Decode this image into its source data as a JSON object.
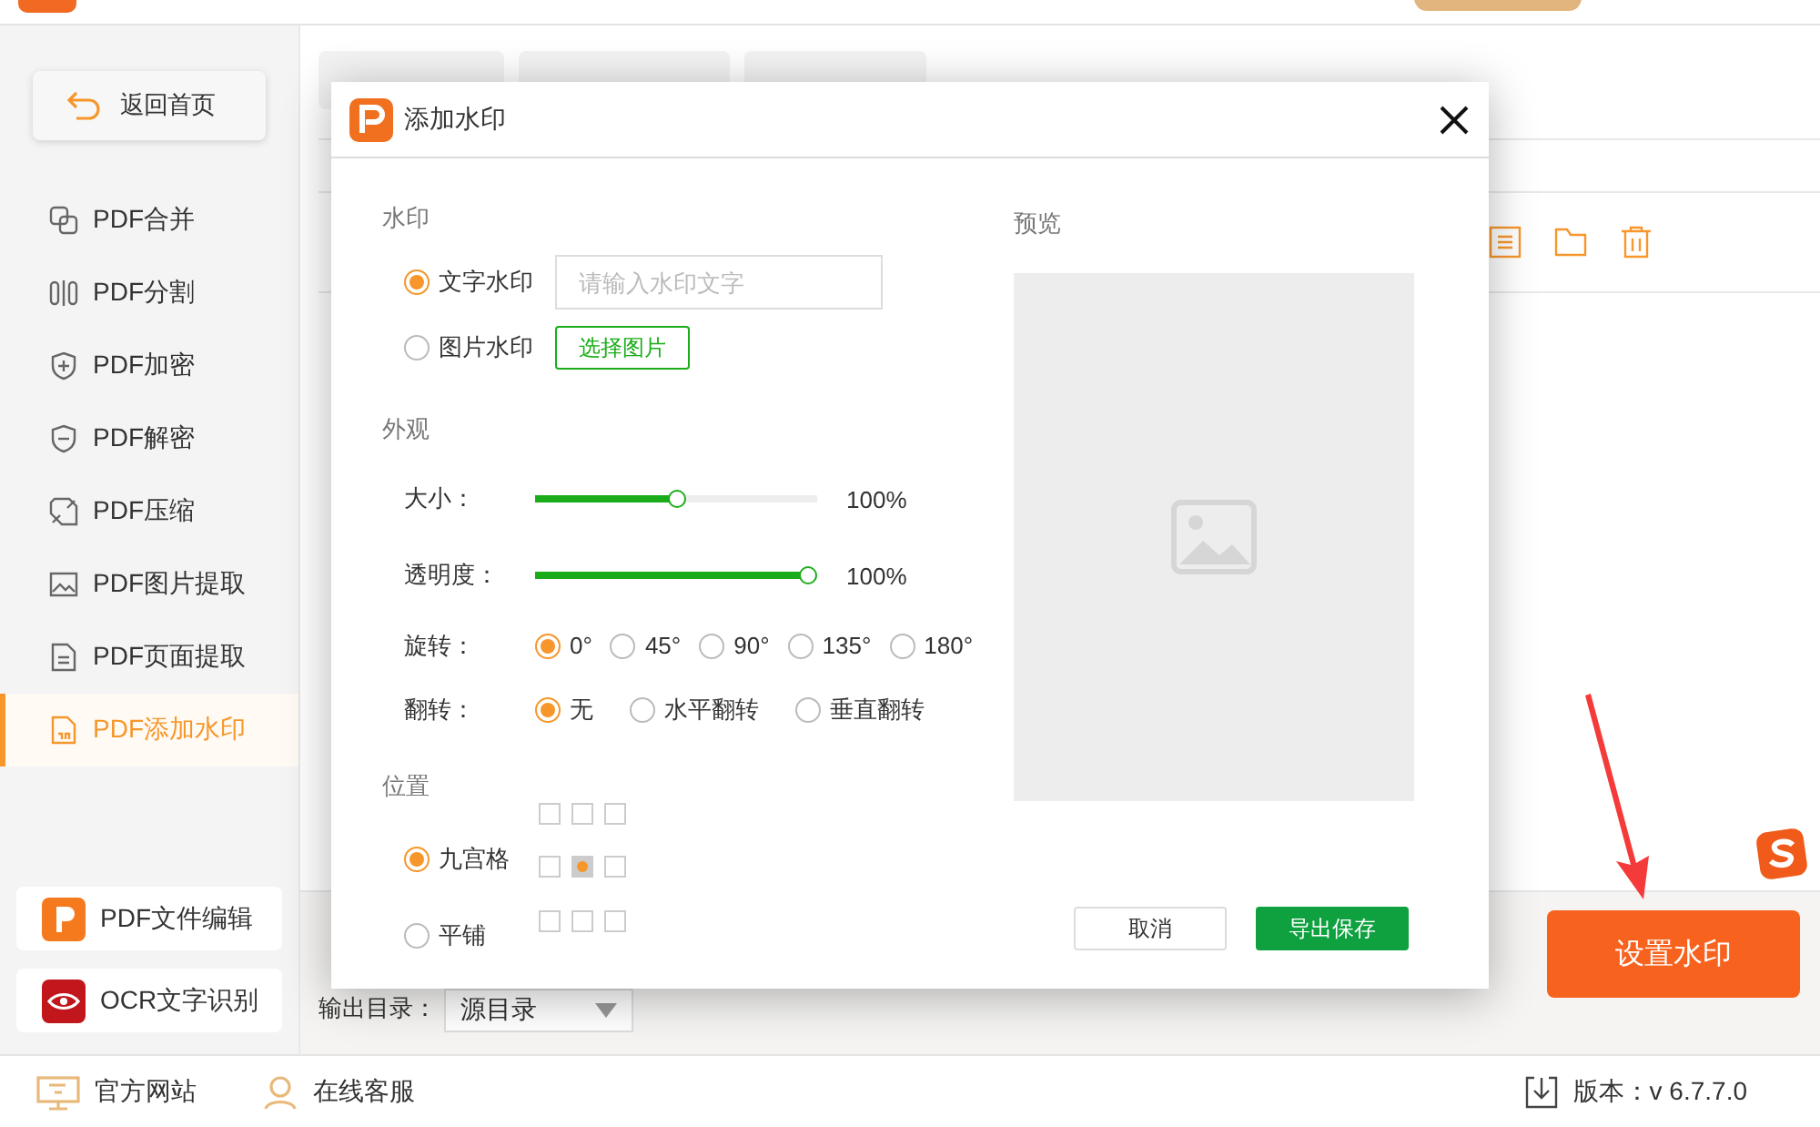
{
  "app": {
    "back_button": "返回首页",
    "toolbar": [
      {
        "kind": "file"
      },
      {
        "kind": "folder"
      },
      {
        "kind": "clear"
      }
    ],
    "nav": [
      {
        "label": "PDF合并",
        "kind": "merge",
        "selected": false
      },
      {
        "label": "PDF分割",
        "kind": "split",
        "selected": false
      },
      {
        "label": "PDF加密",
        "kind": "encrypt",
        "selected": false
      },
      {
        "label": "PDF解密",
        "kind": "decrypt",
        "selected": false
      },
      {
        "label": "PDF压缩",
        "kind": "compress",
        "selected": false
      },
      {
        "label": "PDF图片提取",
        "kind": "image",
        "selected": false
      },
      {
        "label": "PDF页面提取",
        "kind": "page",
        "selected": false
      },
      {
        "label": "PDF添加水印",
        "kind": "watermark",
        "selected": true
      }
    ],
    "tools": [
      {
        "label": "PDF文件编辑",
        "kind": "edit"
      },
      {
        "label": "OCR文字识别",
        "kind": "ocr"
      }
    ],
    "output": {
      "label": "输出目录：",
      "value": "源目录"
    },
    "action_button": "设置水印",
    "status": {
      "links": [
        {
          "label": "官方网站",
          "kind": "site"
        },
        {
          "label": "在线客服",
          "kind": "service"
        }
      ],
      "version": "版本：v 6.7.7.0"
    }
  },
  "dialog": {
    "title": "添加水印",
    "watermark": {
      "heading": "水印",
      "types": [
        {
          "label": "文字水印",
          "kind": "text",
          "selected": true,
          "placeholder": "请输入水印文字"
        },
        {
          "label": "图片水印",
          "kind": "image",
          "selected": false,
          "button": "选择图片"
        }
      ]
    },
    "appearance": {
      "heading": "外观",
      "sliders": [
        {
          "label": "大小：",
          "level": 0.5,
          "reading": "100%"
        },
        {
          "label": "透明度：",
          "level": 1,
          "reading": "100%"
        }
      ],
      "groups": [
        {
          "label": "旋转：",
          "options": [
            {
              "label": "0°",
              "selected": true
            },
            {
              "label": "45°",
              "selected": false
            },
            {
              "label": "90°",
              "selected": false
            },
            {
              "label": "135°",
              "selected": false
            },
            {
              "label": "180°",
              "selected": false
            }
          ]
        },
        {
          "label": "翻转：",
          "options": [
            {
              "label": "无",
              "selected": true
            },
            {
              "label": "水平翻转",
              "selected": false
            },
            {
              "label": "垂直翻转",
              "selected": false
            }
          ]
        }
      ]
    },
    "position": {
      "heading": "位置",
      "modes": [
        {
          "label": "九宫格",
          "selected": true
        },
        {
          "label": "平铺",
          "selected": false
        }
      ],
      "grid": [
        {
          "selected": false
        },
        {
          "selected": false
        },
        {
          "selected": false
        },
        {
          "selected": false
        },
        {
          "selected": true
        },
        {
          "selected": false
        },
        {
          "selected": false
        },
        {
          "selected": false
        },
        {
          "selected": false
        }
      ]
    },
    "preview": {
      "heading": "预览"
    },
    "buttons": [
      {
        "label": "取消",
        "kind": "secondary"
      },
      {
        "label": "导出保存",
        "kind": "primary"
      }
    ]
  }
}
